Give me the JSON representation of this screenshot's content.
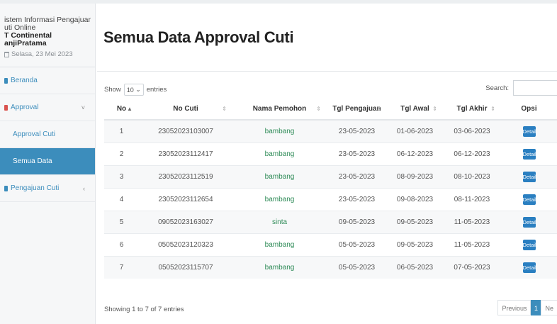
{
  "sidebar": {
    "brand_line1": "istem Informasi Pengajuan",
    "brand_line2": "uti Online",
    "brand_line3": "T Continental",
    "brand_line4": "anjiPratama",
    "date": "Selasa, 23 Mei 2023",
    "items": [
      {
        "label": "Beranda"
      },
      {
        "label": "Approval",
        "chev": "˅"
      },
      {
        "label": "Approval Cuti"
      },
      {
        "label": "Semua Data"
      },
      {
        "label": "Pengajuan Cuti",
        "chev": "‹"
      }
    ]
  },
  "page_title": "Semua Data Approval Cuti",
  "controls": {
    "show": "Show",
    "entries_value": "10",
    "entries": "entries",
    "search_label": "Search:"
  },
  "table": {
    "headers": [
      "No",
      "No Cuti",
      "Nama Pemohon",
      "Tgl Pengajuan",
      "Tgl Awal",
      "Tgl Akhir",
      "Opsi"
    ],
    "detail_label": "Detail",
    "rows": [
      {
        "no": "1",
        "no_cuti": "23052023103007",
        "nama": "bambang",
        "tgl_pengajuan": "23-05-2023",
        "tgl_awal": "01-06-2023",
        "tgl_akhir": "03-06-2023"
      },
      {
        "no": "2",
        "no_cuti": "23052023112417",
        "nama": "bambang",
        "tgl_pengajuan": "23-05-2023",
        "tgl_awal": "06-12-2023",
        "tgl_akhir": "06-12-2023"
      },
      {
        "no": "3",
        "no_cuti": "23052023112519",
        "nama": "bambang",
        "tgl_pengajuan": "23-05-2023",
        "tgl_awal": "08-09-2023",
        "tgl_akhir": "08-10-2023"
      },
      {
        "no": "4",
        "no_cuti": "23052023112654",
        "nama": "bambang",
        "tgl_pengajuan": "23-05-2023",
        "tgl_awal": "09-08-2023",
        "tgl_akhir": "08-11-2023"
      },
      {
        "no": "5",
        "no_cuti": "09052023163027",
        "nama": "sinta",
        "tgl_pengajuan": "09-05-2023",
        "tgl_awal": "09-05-2023",
        "tgl_akhir": "11-05-2023"
      },
      {
        "no": "6",
        "no_cuti": "05052023120323",
        "nama": "bambang",
        "tgl_pengajuan": "05-05-2023",
        "tgl_awal": "09-05-2023",
        "tgl_akhir": "11-05-2023"
      },
      {
        "no": "7",
        "no_cuti": "05052023115707",
        "nama": "bambang",
        "tgl_pengajuan": "05-05-2023",
        "tgl_awal": "06-05-2023",
        "tgl_akhir": "07-05-2023"
      }
    ]
  },
  "footer": {
    "info": "Showing 1 to 7 of 7 entries",
    "previous": "Previous",
    "page": "1",
    "next": "Ne"
  }
}
